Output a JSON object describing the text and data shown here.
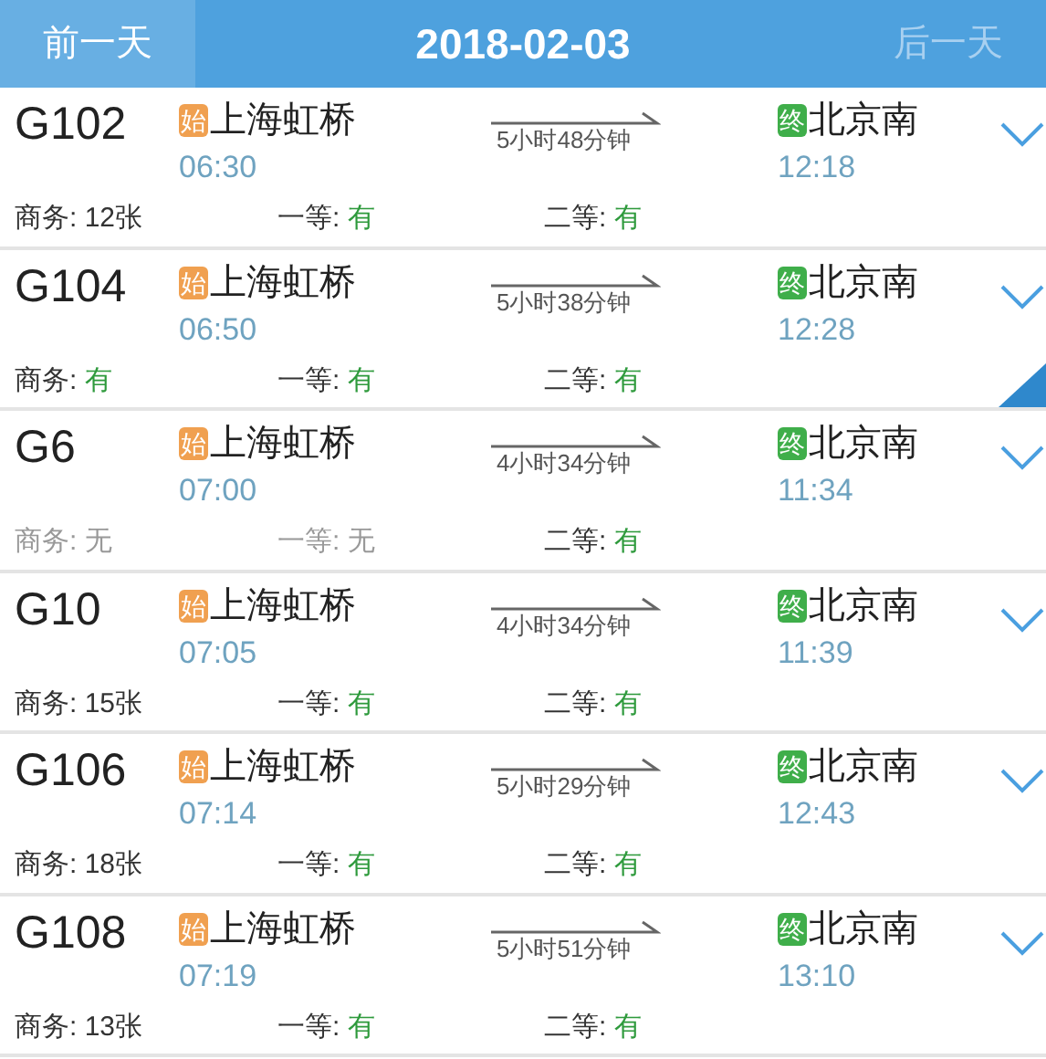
{
  "header": {
    "prev_button": {
      "label": "前一天",
      "disabled": false
    },
    "date": "2018-02-03",
    "next_button": {
      "label": "后一天",
      "disabled": true
    }
  },
  "trains": [
    {
      "number": "G102",
      "from_badge": "始",
      "from": "上海虹桥",
      "depart": "06:30",
      "duration": "5小时48分钟",
      "to_badge": "终",
      "to": "北京南",
      "arrive": "12:18",
      "corner_tag": false,
      "seats": [
        {
          "label": "商务:",
          "value": "12张",
          "kind": "count"
        },
        {
          "label": "一等:",
          "value": "有",
          "kind": "yes"
        },
        {
          "label": "二等:",
          "value": "有",
          "kind": "yes"
        }
      ]
    },
    {
      "number": "G104",
      "from_badge": "始",
      "from": "上海虹桥",
      "depart": "06:50",
      "duration": "5小时38分钟",
      "to_badge": "终",
      "to": "北京南",
      "arrive": "12:28",
      "corner_tag": true,
      "seats": [
        {
          "label": "商务:",
          "value": "有",
          "kind": "yes"
        },
        {
          "label": "一等:",
          "value": "有",
          "kind": "yes"
        },
        {
          "label": "二等:",
          "value": "有",
          "kind": "yes"
        }
      ]
    },
    {
      "number": "G6",
      "from_badge": "始",
      "from": "上海虹桥",
      "depart": "07:00",
      "duration": "4小时34分钟",
      "to_badge": "终",
      "to": "北京南",
      "arrive": "11:34",
      "corner_tag": false,
      "seats": [
        {
          "label": "商务:",
          "value": "无",
          "kind": "none"
        },
        {
          "label": "一等:",
          "value": "无",
          "kind": "none"
        },
        {
          "label": "二等:",
          "value": "有",
          "kind": "yes"
        }
      ]
    },
    {
      "number": "G10",
      "from_badge": "始",
      "from": "上海虹桥",
      "depart": "07:05",
      "duration": "4小时34分钟",
      "to_badge": "终",
      "to": "北京南",
      "arrive": "11:39",
      "corner_tag": false,
      "seats": [
        {
          "label": "商务:",
          "value": "15张",
          "kind": "count"
        },
        {
          "label": "一等:",
          "value": "有",
          "kind": "yes"
        },
        {
          "label": "二等:",
          "value": "有",
          "kind": "yes"
        }
      ]
    },
    {
      "number": "G106",
      "from_badge": "始",
      "from": "上海虹桥",
      "depart": "07:14",
      "duration": "5小时29分钟",
      "to_badge": "终",
      "to": "北京南",
      "arrive": "12:43",
      "corner_tag": false,
      "seats": [
        {
          "label": "商务:",
          "value": "18张",
          "kind": "count"
        },
        {
          "label": "一等:",
          "value": "有",
          "kind": "yes"
        },
        {
          "label": "二等:",
          "value": "有",
          "kind": "yes"
        }
      ]
    },
    {
      "number": "G108",
      "from_badge": "始",
      "from": "上海虹桥",
      "depart": "07:19",
      "duration": "5小时51分钟",
      "to_badge": "终",
      "to": "北京南",
      "arrive": "13:10",
      "corner_tag": false,
      "seats": [
        {
          "label": "商务:",
          "value": "13张",
          "kind": "count"
        },
        {
          "label": "一等:",
          "value": "有",
          "kind": "yes"
        },
        {
          "label": "二等:",
          "value": "有",
          "kind": "yes"
        }
      ]
    }
  ]
}
